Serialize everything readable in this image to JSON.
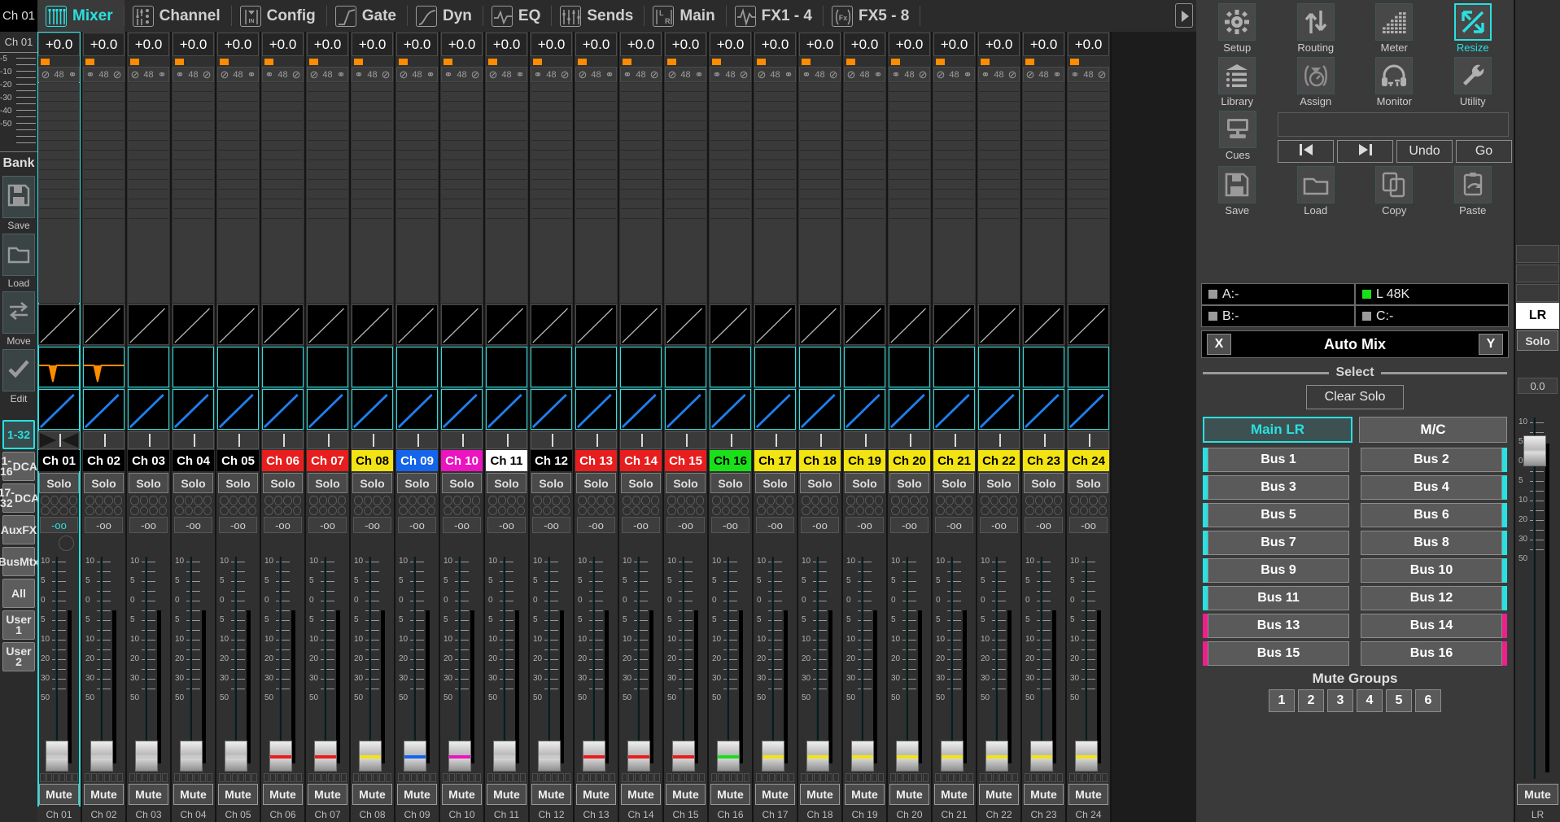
{
  "tabs": [
    {
      "label": "Mixer",
      "icon": "faders-icon",
      "active": true
    },
    {
      "label": "Channel",
      "icon": "channel-icon",
      "active": false
    },
    {
      "label": "Config",
      "icon": "config-in-icon",
      "active": false
    },
    {
      "label": "Gate",
      "icon": "gate-curve-icon",
      "active": false
    },
    {
      "label": "Dyn",
      "icon": "dyn-curve-icon",
      "active": false
    },
    {
      "label": "EQ",
      "icon": "eq-curve-icon",
      "active": false
    },
    {
      "label": "Sends",
      "icon": "sends-icon",
      "active": false
    },
    {
      "label": "Main",
      "icon": "main-lr-icon",
      "active": false
    },
    {
      "label": "FX1 - 4",
      "icon": "fx-wave-icon",
      "active": false
    },
    {
      "label": "FX5 - 8",
      "icon": "fx-box-icon",
      "active": false
    }
  ],
  "sidebar": {
    "channel_top": "Ch 01",
    "channel_label": "Ch 01",
    "meter_scale": [
      "-5",
      "-10",
      "-20",
      "-30",
      "-40",
      "-50"
    ],
    "bank_label": "Bank",
    "bank_buttons": [
      {
        "label": "Save",
        "icon": "floppy-icon"
      },
      {
        "label": "Load",
        "icon": "folder-icon"
      },
      {
        "label": "Move",
        "icon": "swap-arrows-icon"
      },
      {
        "label": "Edit",
        "icon": "check-icon"
      }
    ],
    "layers": [
      {
        "label": "1-32",
        "active": true
      },
      {
        "label": "1-16\nDCA",
        "active": false
      },
      {
        "label": "17-32\nDCA",
        "active": false
      },
      {
        "label": "Aux\nFX",
        "active": false
      },
      {
        "label": "Bus\nMtx",
        "active": false
      },
      {
        "label": "All",
        "active": false
      },
      {
        "label": "User 1",
        "active": false
      },
      {
        "label": "User 2",
        "active": false
      }
    ]
  },
  "strip_common": {
    "gain": "+0.0",
    "src_48": "48",
    "phase_icon": "phase-invert-icon",
    "link_icon": "link-icon",
    "solo_label": "Solo",
    "mute_label": "Mute",
    "level": "-oo",
    "fader_scale": [
      "10",
      "5",
      "0",
      "5",
      "10",
      "20",
      "30",
      "50"
    ]
  },
  "channels": [
    {
      "name": "Ch 01",
      "color": "#000000",
      "text": "#ffffff",
      "selected": true,
      "fader_stripe": "#c9c9c9",
      "has_eq_dip": true
    },
    {
      "name": "Ch 02",
      "color": "#000000",
      "text": "#ffffff",
      "selected": false,
      "fader_stripe": "#c9c9c9",
      "has_eq_dip": true
    },
    {
      "name": "Ch 03",
      "color": "#000000",
      "text": "#ffffff",
      "selected": false,
      "fader_stripe": "#c9c9c9",
      "has_eq_dip": false
    },
    {
      "name": "Ch 04",
      "color": "#000000",
      "text": "#ffffff",
      "selected": false,
      "fader_stripe": "#c9c9c9",
      "has_eq_dip": false
    },
    {
      "name": "Ch 05",
      "color": "#000000",
      "text": "#ffffff",
      "selected": false,
      "fader_stripe": "#c9c9c9",
      "has_eq_dip": false
    },
    {
      "name": "Ch 06",
      "color": "#e81e1e",
      "text": "#ffffff",
      "selected": false,
      "fader_stripe": "#e81e1e",
      "has_eq_dip": false
    },
    {
      "name": "Ch 07",
      "color": "#e81e1e",
      "text": "#ffffff",
      "selected": false,
      "fader_stripe": "#e81e1e",
      "has_eq_dip": false
    },
    {
      "name": "Ch 08",
      "color": "#f2e312",
      "text": "#000000",
      "selected": false,
      "fader_stripe": "#f2e312",
      "has_eq_dip": false
    },
    {
      "name": "Ch 09",
      "color": "#1565ec",
      "text": "#ffffff",
      "selected": false,
      "fader_stripe": "#1565ec",
      "has_eq_dip": false
    },
    {
      "name": "Ch 10",
      "color": "#ec13c0",
      "text": "#ffffff",
      "selected": false,
      "fader_stripe": "#ec13c0",
      "has_eq_dip": false
    },
    {
      "name": "Ch 11",
      "color": "#ffffff",
      "text": "#000000",
      "selected": false,
      "fader_stripe": "#c9c9c9",
      "has_eq_dip": false
    },
    {
      "name": "Ch 12",
      "color": "#000000",
      "text": "#ffffff",
      "selected": false,
      "fader_stripe": "#c9c9c9",
      "has_eq_dip": false
    },
    {
      "name": "Ch 13",
      "color": "#e81e1e",
      "text": "#ffffff",
      "selected": false,
      "fader_stripe": "#e81e1e",
      "has_eq_dip": false
    },
    {
      "name": "Ch 14",
      "color": "#e81e1e",
      "text": "#ffffff",
      "selected": false,
      "fader_stripe": "#e81e1e",
      "has_eq_dip": false
    },
    {
      "name": "Ch 15",
      "color": "#e81e1e",
      "text": "#ffffff",
      "selected": false,
      "fader_stripe": "#e81e1e",
      "has_eq_dip": false
    },
    {
      "name": "Ch 16",
      "color": "#19e019",
      "text": "#000000",
      "selected": false,
      "fader_stripe": "#19e019",
      "has_eq_dip": false
    },
    {
      "name": "Ch 17",
      "color": "#f2e312",
      "text": "#000000",
      "selected": false,
      "fader_stripe": "#f2e312",
      "has_eq_dip": false
    },
    {
      "name": "Ch 18",
      "color": "#f2e312",
      "text": "#000000",
      "selected": false,
      "fader_stripe": "#f2e312",
      "has_eq_dip": false
    },
    {
      "name": "Ch 19",
      "color": "#f2e312",
      "text": "#000000",
      "selected": false,
      "fader_stripe": "#f2e312",
      "has_eq_dip": false
    },
    {
      "name": "Ch 20",
      "color": "#f2e312",
      "text": "#000000",
      "selected": false,
      "fader_stripe": "#f2e312",
      "has_eq_dip": false
    },
    {
      "name": "Ch 21",
      "color": "#f2e312",
      "text": "#000000",
      "selected": false,
      "fader_stripe": "#f2e312",
      "has_eq_dip": false
    },
    {
      "name": "Ch 22",
      "color": "#f2e312",
      "text": "#000000",
      "selected": false,
      "fader_stripe": "#f2e312",
      "has_eq_dip": false
    },
    {
      "name": "Ch 23",
      "color": "#f2e312",
      "text": "#000000",
      "selected": false,
      "fader_stripe": "#f2e312",
      "has_eq_dip": false
    },
    {
      "name": "Ch 24",
      "color": "#f2e312",
      "text": "#000000",
      "selected": false,
      "fader_stripe": "#f2e312",
      "has_eq_dip": false
    }
  ],
  "right_panel": {
    "tools_row1": [
      {
        "label": "Setup",
        "icon": "gear-icon",
        "active": false
      },
      {
        "label": "Routing",
        "icon": "up-down-arrows-icon",
        "active": false
      },
      {
        "label": "Meter",
        "icon": "meter-dots-icon",
        "active": false
      },
      {
        "label": "Resize",
        "icon": "resize-diagonal-icon",
        "active": true
      }
    ],
    "tools_row2": [
      {
        "label": "Library",
        "icon": "library-list-icon",
        "active": false
      },
      {
        "label": "Assign",
        "icon": "assign-dial-icon",
        "active": false
      },
      {
        "label": "Monitor",
        "icon": "headphones-icon",
        "active": false
      },
      {
        "label": "Utility",
        "icon": "wrench-icon",
        "active": false
      }
    ],
    "cues": {
      "label": "Cues",
      "icon": "monitor-screen-icon"
    },
    "transport": [
      {
        "label": "|<",
        "icon": "prev-track-icon"
      },
      {
        "label": ">|",
        "icon": "next-track-icon"
      },
      {
        "label": "Undo",
        "icon": "undo-icon"
      },
      {
        "label": "Go",
        "icon": "go-icon"
      }
    ],
    "tools_row3": [
      {
        "label": "Save",
        "icon": "floppy-icon",
        "active": false
      },
      {
        "label": "Load",
        "icon": "folder-icon",
        "active": false
      },
      {
        "label": "Copy",
        "icon": "copy-pages-icon",
        "active": false
      },
      {
        "label": "Paste",
        "icon": "clipboard-paste-icon",
        "active": false
      }
    ],
    "status": [
      {
        "label": "A:-",
        "on": false
      },
      {
        "label": "L   48K",
        "on": true
      },
      {
        "label": "B:-",
        "on": false
      },
      {
        "label": "C:-",
        "on": false
      }
    ],
    "automix": {
      "x": "X",
      "label": "Auto Mix",
      "y": "Y"
    },
    "select_label": "Select",
    "clear_solo": "Clear Solo",
    "mains": [
      {
        "label": "Main LR",
        "active": true
      },
      {
        "label": "M/C",
        "active": false
      }
    ],
    "buses": [
      {
        "label": "Bus 1",
        "ind": "#2ae0e0",
        "side": "l"
      },
      {
        "label": "Bus 2",
        "ind": "#2ae0e0",
        "side": "r"
      },
      {
        "label": "Bus 3",
        "ind": "#2ae0e0",
        "side": "l"
      },
      {
        "label": "Bus 4",
        "ind": "#2ae0e0",
        "side": "r"
      },
      {
        "label": "Bus 5",
        "ind": "#2ae0e0",
        "side": "l"
      },
      {
        "label": "Bus 6",
        "ind": "#2ae0e0",
        "side": "r"
      },
      {
        "label": "Bus 7",
        "ind": "#2ae0e0",
        "side": "l"
      },
      {
        "label": "Bus 8",
        "ind": "#2ae0e0",
        "side": "r"
      },
      {
        "label": "Bus 9",
        "ind": "#2ae0e0",
        "side": "l"
      },
      {
        "label": "Bus 10",
        "ind": "#2ae0e0",
        "side": "r"
      },
      {
        "label": "Bus 11",
        "ind": "#2ae0e0",
        "side": "l"
      },
      {
        "label": "Bus 12",
        "ind": "#2ae0e0",
        "side": "r"
      },
      {
        "label": "Bus 13",
        "ind": "#ec1f8c",
        "side": "l"
      },
      {
        "label": "Bus 14",
        "ind": "#ec1f8c",
        "side": "r"
      },
      {
        "label": "Bus 15",
        "ind": "#ec1f8c",
        "side": "l"
      },
      {
        "label": "Bus 16",
        "ind": "#ec1f8c",
        "side": "r"
      }
    ],
    "mute_groups_label": "Mute Groups",
    "mute_groups": [
      "1",
      "2",
      "3",
      "4",
      "5",
      "6"
    ]
  },
  "lr_strip": {
    "name": "LR",
    "solo": "Solo",
    "level": "0.0",
    "mute": "Mute",
    "bottom": "LR",
    "fader_scale": [
      "10",
      "5",
      "0",
      "5",
      "10",
      "20",
      "30",
      "50"
    ]
  }
}
